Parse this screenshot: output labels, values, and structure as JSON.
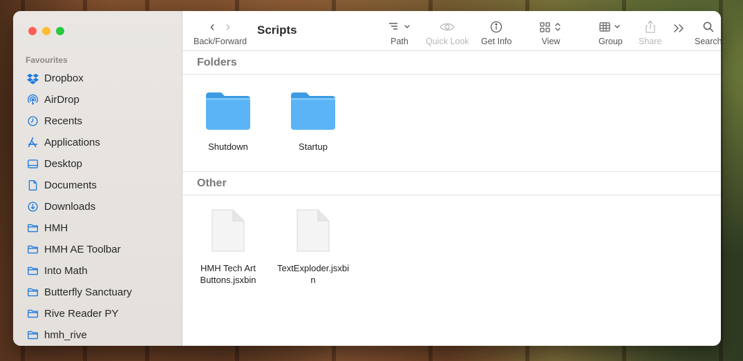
{
  "window": {
    "title": "Scripts"
  },
  "traffic_lights": {
    "close": "#ff5f57",
    "minimize": "#febc2e",
    "zoom": "#28c840"
  },
  "sidebar": {
    "section_title": "Favourites",
    "items": [
      {
        "label": "Dropbox",
        "icon": "dropbox-icon"
      },
      {
        "label": "AirDrop",
        "icon": "airdrop-icon"
      },
      {
        "label": "Recents",
        "icon": "clock-icon"
      },
      {
        "label": "Applications",
        "icon": "applications-icon"
      },
      {
        "label": "Desktop",
        "icon": "desktop-icon"
      },
      {
        "label": "Documents",
        "icon": "document-icon"
      },
      {
        "label": "Downloads",
        "icon": "download-icon"
      },
      {
        "label": "HMH",
        "icon": "folder-icon"
      },
      {
        "label": "HMH AE Toolbar",
        "icon": "folder-icon"
      },
      {
        "label": "Into Math",
        "icon": "folder-icon"
      },
      {
        "label": "Butterfly Sanctuary",
        "icon": "folder-icon"
      },
      {
        "label": "Rive Reader PY",
        "icon": "folder-icon"
      },
      {
        "label": "hmh_rive",
        "icon": "folder-icon"
      }
    ]
  },
  "toolbar": {
    "back_forward_label": "Back/Forward",
    "path_label": "Path",
    "quick_look_label": "Quick Look",
    "get_info_label": "Get Info",
    "view_label": "View",
    "group_label": "Group",
    "share_label": "Share",
    "search_label": "Search"
  },
  "sections": {
    "folders": {
      "title": "Folders",
      "items": [
        {
          "name": "Shutdown"
        },
        {
          "name": "Startup"
        }
      ]
    },
    "other": {
      "title": "Other",
      "items": [
        {
          "line1": "HMH Tech Art",
          "line2": "Buttons.jsxbin"
        },
        {
          "line1": "TextExploder.jsxbi",
          "line2": "n"
        }
      ]
    }
  },
  "colors": {
    "accent": "#1f7ae0",
    "folder": "#5ab4f5",
    "folder_dark": "#3e9be2"
  }
}
